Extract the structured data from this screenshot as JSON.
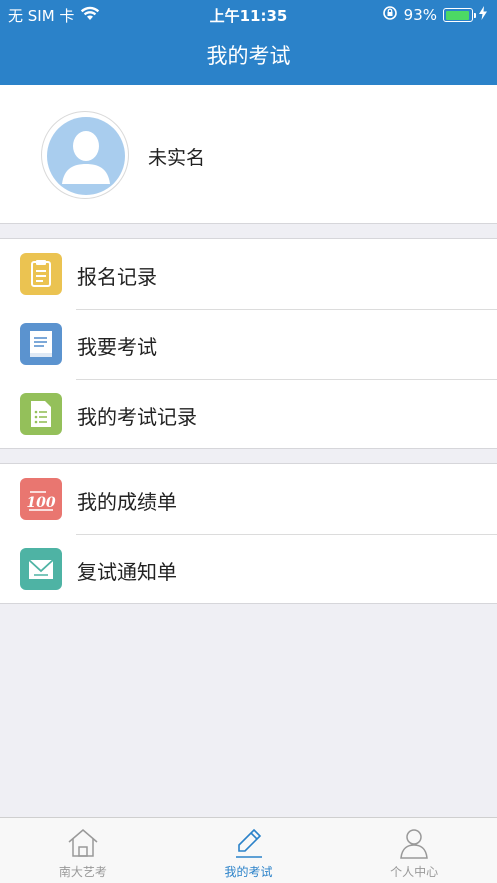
{
  "status_bar": {
    "carrier": "无 SIM 卡",
    "time": "上午11:35",
    "battery_percent": "93%",
    "battery_level": 0.93
  },
  "nav": {
    "title": "我的考试"
  },
  "profile": {
    "name": "未实名",
    "avatar_icon": "user-avatar-icon"
  },
  "menu_group1": [
    {
      "label": "报名记录",
      "icon": "clipboard-icon",
      "color": "#ebc351"
    },
    {
      "label": "我要考试",
      "icon": "book-icon",
      "color": "#5b93cf"
    },
    {
      "label": "我的考试记录",
      "icon": "list-document-icon",
      "color": "#94c05a"
    }
  ],
  "menu_group2": [
    {
      "label": "我的成绩单",
      "icon": "score-100-icon",
      "color": "#e97670"
    },
    {
      "label": "复试通知单",
      "icon": "envelope-icon",
      "color": "#4eb3a4"
    }
  ],
  "tabbar": [
    {
      "label": "南大艺考",
      "icon": "home-icon",
      "active": false
    },
    {
      "label": "我的考试",
      "icon": "pencil-icon",
      "active": true
    },
    {
      "label": "个人中心",
      "icon": "person-icon",
      "active": false
    }
  ],
  "colors": {
    "accent": "#2b82c9",
    "background": "#efeff4"
  }
}
